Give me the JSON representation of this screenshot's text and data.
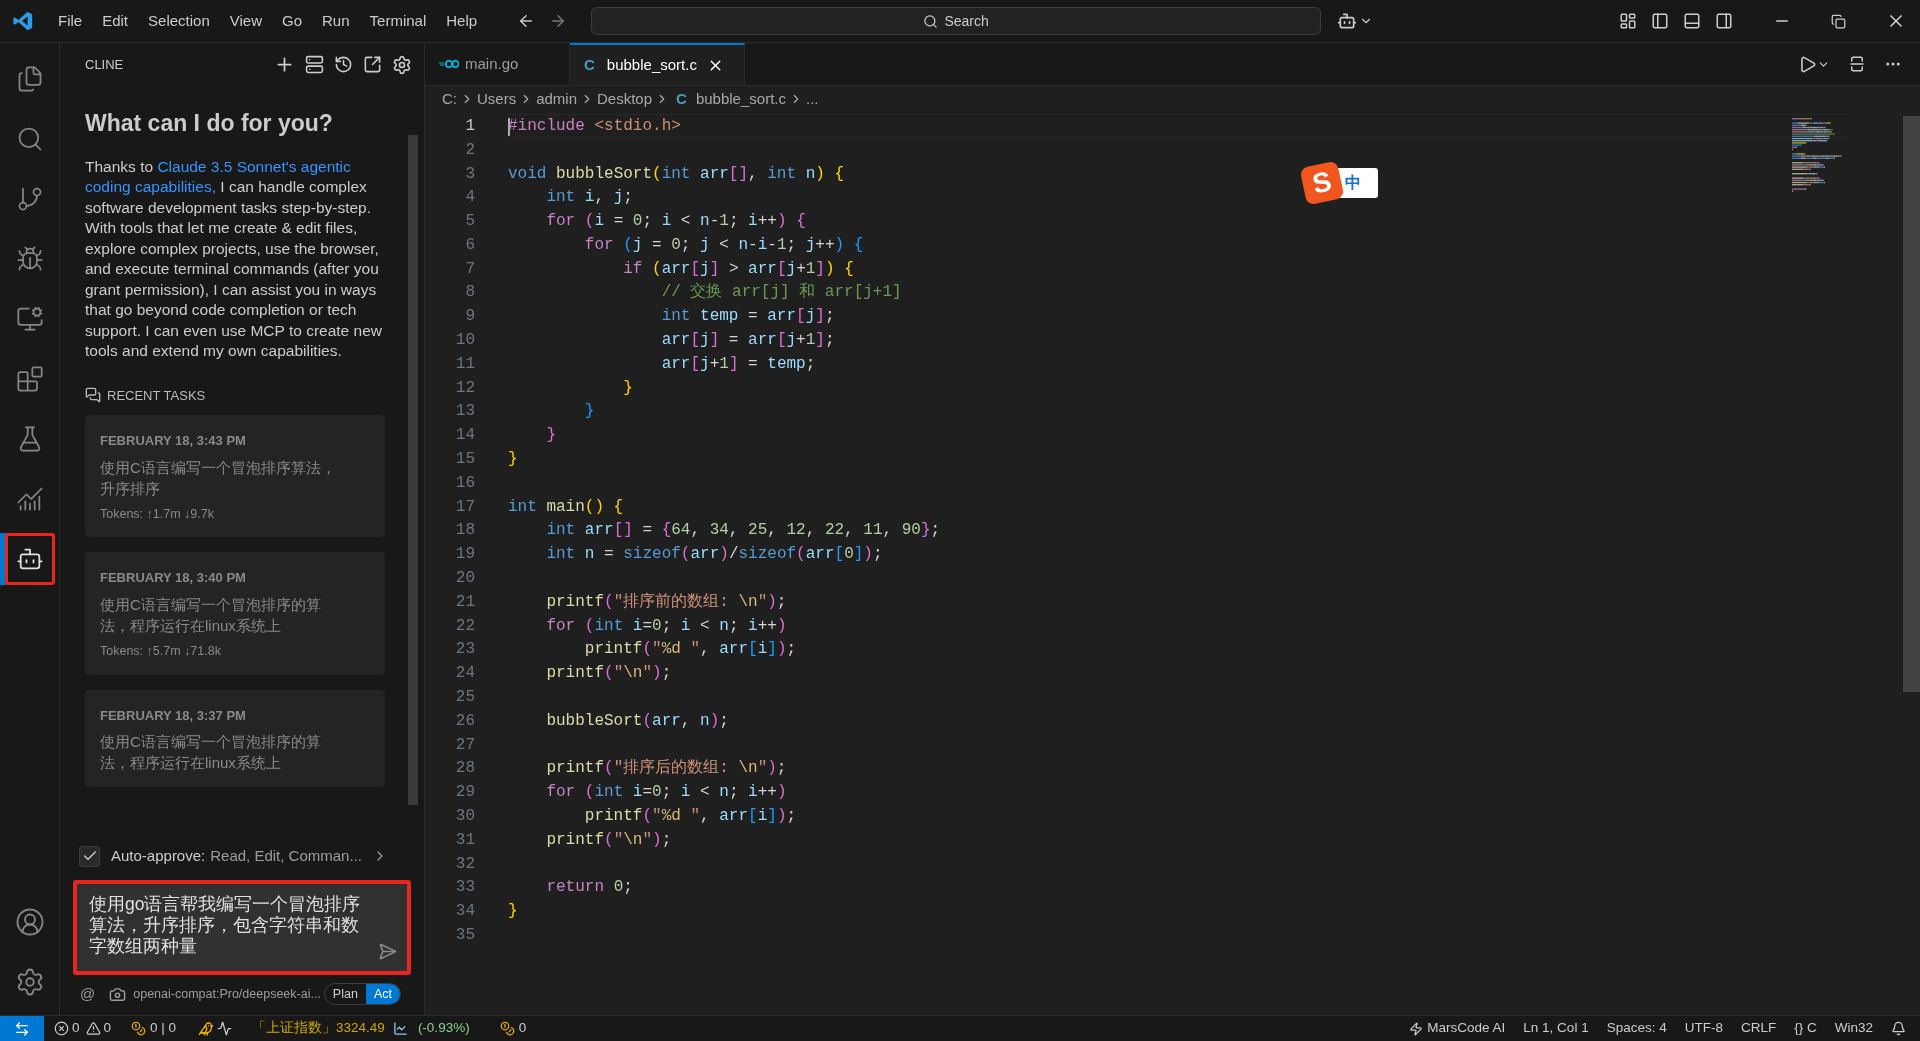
{
  "title_bar": {
    "menu": [
      "File",
      "Edit",
      "Selection",
      "View",
      "Go",
      "Run",
      "Terminal",
      "Help"
    ],
    "search": {
      "placeholder": "Search"
    }
  },
  "activity_bar": {
    "items": [
      {
        "selected": false,
        "annotated": false
      },
      {
        "selected": false,
        "annotated": false
      },
      {
        "selected": false,
        "annotated": false
      },
      {
        "selected": false,
        "annotated": false
      },
      {
        "selected": false,
        "annotated": false
      },
      {
        "selected": false,
        "annotated": false
      },
      {
        "selected": false,
        "annotated": false
      },
      {
        "selected": false,
        "annotated": false
      },
      {
        "selected": true,
        "annotated": true
      }
    ]
  },
  "side_panel": {
    "title": "CLINE",
    "heading": "What can I do for you?",
    "intro_lead": "Thanks to",
    "intro_link": [
      "Claude 3.5 Sonnet's agentic",
      "coding capabilities,"
    ],
    "intro_rest": "I can handle complex software development tasks step-by-step. With tools that let me create & edit files, explore complex projects, use the browser, and execute terminal commands (after you grant permission), I can assist you in ways that go beyond code completion or tech support. I can even use MCP to create new tools and extend my own capabilities.",
    "recent_tasks": {
      "title": "RECENT TASKS",
      "tasks": [
        {
          "date": "FEBRUARY 18, 3:43 PM",
          "text": "使用C语言编写一个冒泡排序算法，升序排序",
          "tokens": "Tokens: ↑1.7m ↓9.7k"
        },
        {
          "date": "FEBRUARY 18, 3:40 PM",
          "text": "使用C语言编写一个冒泡排序的算法，程序运行在linux系统上",
          "tokens": "Tokens: ↑5.7m ↓71.8k"
        },
        {
          "date": "FEBRUARY 18, 3:37 PM",
          "text": "使用C语言编写一个冒泡排序的算法，程序运行在linux系统上"
        }
      ]
    },
    "auto_approve": {
      "checked": true,
      "label": "Auto-approve:",
      "value": "Read, Edit, Comman..."
    },
    "input": {
      "value": "使用go语言帮我编写一个冒泡排序算法，升序排序，包含字符串和数字数组两种量",
      "annotated": true
    },
    "footer": {
      "mention": "@",
      "model": "openai-compat:Pro/deepseek-ai...",
      "modes": [
        {
          "label": "Plan",
          "selected": false
        },
        {
          "label": "Act",
          "selected": true
        }
      ]
    }
  },
  "editor": {
    "tabs": [
      {
        "label": "main.go",
        "selected": false
      },
      {
        "label": "bubble_sort.c",
        "icon_letter": "C",
        "selected": true
      }
    ],
    "breadcrumbs": [
      "C:",
      "Users",
      "admin",
      "Desktop",
      "bubble_sort.c",
      "..."
    ],
    "breadcrumb_icon_letter": "C",
    "ime": {
      "logo": "S",
      "mode": "中"
    },
    "lines": [
      {
        "n": "1",
        "current": true,
        "t": [
          {
            "kind": "pre",
            "text": "#include "
          },
          {
            "kind": "inc",
            "text": "<stdio.h>"
          }
        ]
      },
      {
        "n": "2",
        "current": false
      },
      {
        "n": "3",
        "current": false,
        "t": [
          {
            "kind": "ty",
            "text": "void "
          },
          {
            "kind": "fn",
            "text": "bubbleSort"
          },
          {
            "kind": "b1",
            "text": "("
          },
          {
            "kind": "ty",
            "text": "int "
          },
          {
            "kind": "v",
            "text": "arr"
          },
          {
            "kind": "b2",
            "text": "[]"
          },
          {
            "kind": "p",
            "text": ", "
          },
          {
            "kind": "ty",
            "text": "int "
          },
          {
            "kind": "v",
            "text": "n"
          },
          {
            "kind": "b1",
            "text": ")"
          },
          {
            "kind": "b1",
            "text": " {"
          }
        ]
      },
      {
        "n": "4",
        "current": false,
        "t": [
          {
            "kind": "ty",
            "text": "    int "
          },
          {
            "kind": "v",
            "text": "i"
          },
          {
            "kind": "p",
            "text": ", "
          },
          {
            "kind": "v",
            "text": "j"
          },
          {
            "kind": "p",
            "text": ";"
          }
        ]
      },
      {
        "n": "5",
        "current": false,
        "t": [
          {
            "kind": "kw",
            "text": "    for "
          },
          {
            "kind": "b2",
            "text": "("
          },
          {
            "kind": "v",
            "text": "i"
          },
          {
            "kind": "p",
            "text": " = "
          },
          {
            "kind": "n",
            "text": "0"
          },
          {
            "kind": "p",
            "text": "; "
          },
          {
            "kind": "v",
            "text": "i"
          },
          {
            "kind": "p",
            "text": " < "
          },
          {
            "kind": "v",
            "text": "n"
          },
          {
            "kind": "p",
            "text": "-"
          },
          {
            "kind": "n",
            "text": "1"
          },
          {
            "kind": "p",
            "text": "; "
          },
          {
            "kind": "v",
            "text": "i"
          },
          {
            "kind": "p",
            "text": "++"
          },
          {
            "kind": "b2",
            "text": ")"
          },
          {
            "kind": "b2",
            "text": " {"
          }
        ]
      },
      {
        "n": "6",
        "current": false,
        "t": [
          {
            "kind": "kw",
            "text": "        for "
          },
          {
            "kind": "b3",
            "text": "("
          },
          {
            "kind": "v",
            "text": "j"
          },
          {
            "kind": "p",
            "text": " = "
          },
          {
            "kind": "n",
            "text": "0"
          },
          {
            "kind": "p",
            "text": "; "
          },
          {
            "kind": "v",
            "text": "j"
          },
          {
            "kind": "p",
            "text": " < "
          },
          {
            "kind": "v",
            "text": "n"
          },
          {
            "kind": "p",
            "text": "-"
          },
          {
            "kind": "v",
            "text": "i"
          },
          {
            "kind": "p",
            "text": "-"
          },
          {
            "kind": "n",
            "text": "1"
          },
          {
            "kind": "p",
            "text": "; "
          },
          {
            "kind": "v",
            "text": "j"
          },
          {
            "kind": "p",
            "text": "++"
          },
          {
            "kind": "b3",
            "text": ")"
          },
          {
            "kind": "b3",
            "text": " {"
          }
        ]
      },
      {
        "n": "7",
        "current": false,
        "t": [
          {
            "kind": "kw",
            "text": "            if "
          },
          {
            "kind": "b1",
            "text": "("
          },
          {
            "kind": "v",
            "text": "arr"
          },
          {
            "kind": "b2",
            "text": "["
          },
          {
            "kind": "v",
            "text": "j"
          },
          {
            "kind": "b2",
            "text": "]"
          },
          {
            "kind": "p",
            "text": " > "
          },
          {
            "kind": "v",
            "text": "arr"
          },
          {
            "kind": "b2",
            "text": "["
          },
          {
            "kind": "v",
            "text": "j"
          },
          {
            "kind": "p",
            "text": "+"
          },
          {
            "kind": "n",
            "text": "1"
          },
          {
            "kind": "b2",
            "text": "]"
          },
          {
            "kind": "b1",
            "text": ")"
          },
          {
            "kind": "b1",
            "text": " {"
          }
        ]
      },
      {
        "n": "8",
        "current": false,
        "t": [
          {
            "kind": "c",
            "text": "                // 交换 arr[j] 和 arr[j+1]"
          }
        ]
      },
      {
        "n": "9",
        "current": false,
        "t": [
          {
            "kind": "ty",
            "text": "                int "
          },
          {
            "kind": "v",
            "text": "temp"
          },
          {
            "kind": "p",
            "text": " = "
          },
          {
            "kind": "v",
            "text": "arr"
          },
          {
            "kind": "b2",
            "text": "["
          },
          {
            "kind": "v",
            "text": "j"
          },
          {
            "kind": "b2",
            "text": "]"
          },
          {
            "kind": "p",
            "text": ";"
          }
        ]
      },
      {
        "n": "10",
        "current": false,
        "t": [
          {
            "kind": "v",
            "text": "                arr"
          },
          {
            "kind": "b2",
            "text": "["
          },
          {
            "kind": "v",
            "text": "j"
          },
          {
            "kind": "b2",
            "text": "]"
          },
          {
            "kind": "p",
            "text": " = "
          },
          {
            "kind": "v",
            "text": "arr"
          },
          {
            "kind": "b2",
            "text": "["
          },
          {
            "kind": "v",
            "text": "j"
          },
          {
            "kind": "p",
            "text": "+"
          },
          {
            "kind": "n",
            "text": "1"
          },
          {
            "kind": "b2",
            "text": "]"
          },
          {
            "kind": "p",
            "text": ";"
          }
        ]
      },
      {
        "n": "11",
        "current": false,
        "t": [
          {
            "kind": "v",
            "text": "                arr"
          },
          {
            "kind": "b2",
            "text": "["
          },
          {
            "kind": "v",
            "text": "j"
          },
          {
            "kind": "p",
            "text": "+"
          },
          {
            "kind": "n",
            "text": "1"
          },
          {
            "kind": "b2",
            "text": "]"
          },
          {
            "kind": "p",
            "text": " = "
          },
          {
            "kind": "v",
            "text": "temp"
          },
          {
            "kind": "p",
            "text": ";"
          }
        ]
      },
      {
        "n": "12",
        "current": false,
        "t": [
          {
            "kind": "b1",
            "text": "            }"
          }
        ]
      },
      {
        "n": "13",
        "current": false,
        "t": [
          {
            "kind": "b3",
            "text": "        }"
          }
        ]
      },
      {
        "n": "14",
        "current": false,
        "t": [
          {
            "kind": "b2",
            "text": "    }"
          }
        ]
      },
      {
        "n": "15",
        "current": false,
        "t": [
          {
            "kind": "b1",
            "text": "}"
          }
        ]
      },
      {
        "n": "16",
        "current": false
      },
      {
        "n": "17",
        "current": false,
        "t": [
          {
            "kind": "ty",
            "text": "int "
          },
          {
            "kind": "fn",
            "text": "main"
          },
          {
            "kind": "b1",
            "text": "()"
          },
          {
            "kind": "b1",
            "text": " {"
          }
        ]
      },
      {
        "n": "18",
        "current": false,
        "t": [
          {
            "kind": "ty",
            "text": "    int "
          },
          {
            "kind": "v",
            "text": "arr"
          },
          {
            "kind": "b2",
            "text": "[]"
          },
          {
            "kind": "p",
            "text": " = "
          },
          {
            "kind": "b2",
            "text": "{"
          },
          {
            "kind": "n",
            "text": "64"
          },
          {
            "kind": "p",
            "text": ", "
          },
          {
            "kind": "n",
            "text": "34"
          },
          {
            "kind": "p",
            "text": ", "
          },
          {
            "kind": "n",
            "text": "25"
          },
          {
            "kind": "p",
            "text": ", "
          },
          {
            "kind": "n",
            "text": "12"
          },
          {
            "kind": "p",
            "text": ", "
          },
          {
            "kind": "n",
            "text": "22"
          },
          {
            "kind": "p",
            "text": ", "
          },
          {
            "kind": "n",
            "text": "11"
          },
          {
            "kind": "p",
            "text": ", "
          },
          {
            "kind": "n",
            "text": "90"
          },
          {
            "kind": "b2",
            "text": "}"
          },
          {
            "kind": "p",
            "text": ";"
          }
        ]
      },
      {
        "n": "19",
        "current": false,
        "t": [
          {
            "kind": "ty",
            "text": "    int "
          },
          {
            "kind": "v",
            "text": "n"
          },
          {
            "kind": "p",
            "text": " = "
          },
          {
            "kind": "ty",
            "text": "sizeof"
          },
          {
            "kind": "b2",
            "text": "("
          },
          {
            "kind": "v",
            "text": "arr"
          },
          {
            "kind": "b2",
            "text": ")"
          },
          {
            "kind": "p",
            "text": "/"
          },
          {
            "kind": "ty",
            "text": "sizeof"
          },
          {
            "kind": "b2",
            "text": "("
          },
          {
            "kind": "v",
            "text": "arr"
          },
          {
            "kind": "b3",
            "text": "["
          },
          {
            "kind": "n",
            "text": "0"
          },
          {
            "kind": "b3",
            "text": "]"
          },
          {
            "kind": "b2",
            "text": ")"
          },
          {
            "kind": "p",
            "text": ";"
          }
        ]
      },
      {
        "n": "20",
        "current": false
      },
      {
        "n": "21",
        "current": false,
        "t": [
          {
            "kind": "fn",
            "text": "    printf"
          },
          {
            "kind": "b2",
            "text": "("
          },
          {
            "kind": "s",
            "text": "\"排序前的数组: "
          },
          {
            "kind": "esc",
            "text": "\\n"
          },
          {
            "kind": "s",
            "text": "\""
          },
          {
            "kind": "b2",
            "text": ")"
          },
          {
            "kind": "p",
            "text": ";"
          }
        ]
      },
      {
        "n": "22",
        "current": false,
        "t": [
          {
            "kind": "kw",
            "text": "    for "
          },
          {
            "kind": "b2",
            "text": "("
          },
          {
            "kind": "ty",
            "text": "int "
          },
          {
            "kind": "v",
            "text": "i"
          },
          {
            "kind": "p",
            "text": "="
          },
          {
            "kind": "n",
            "text": "0"
          },
          {
            "kind": "p",
            "text": "; "
          },
          {
            "kind": "v",
            "text": "i"
          },
          {
            "kind": "p",
            "text": " < "
          },
          {
            "kind": "v",
            "text": "n"
          },
          {
            "kind": "p",
            "text": "; "
          },
          {
            "kind": "v",
            "text": "i"
          },
          {
            "kind": "p",
            "text": "++"
          },
          {
            "kind": "b2",
            "text": ")"
          }
        ]
      },
      {
        "n": "23",
        "current": false,
        "t": [
          {
            "kind": "fn",
            "text": "        printf"
          },
          {
            "kind": "b2",
            "text": "("
          },
          {
            "kind": "s",
            "text": "\""
          },
          {
            "kind": "esc",
            "text": "%d"
          },
          {
            "kind": "s",
            "text": " \""
          },
          {
            "kind": "p",
            "text": ", "
          },
          {
            "kind": "v",
            "text": "arr"
          },
          {
            "kind": "b3",
            "text": "["
          },
          {
            "kind": "v",
            "text": "i"
          },
          {
            "kind": "b3",
            "text": "]"
          },
          {
            "kind": "b2",
            "text": ")"
          },
          {
            "kind": "p",
            "text": ";"
          }
        ]
      },
      {
        "n": "24",
        "current": false,
        "t": [
          {
            "kind": "fn",
            "text": "    printf"
          },
          {
            "kind": "b2",
            "text": "("
          },
          {
            "kind": "s",
            "text": "\""
          },
          {
            "kind": "esc",
            "text": "\\n"
          },
          {
            "kind": "s",
            "text": "\""
          },
          {
            "kind": "b2",
            "text": ")"
          },
          {
            "kind": "p",
            "text": ";"
          }
        ]
      },
      {
        "n": "25",
        "current": false
      },
      {
        "n": "26",
        "current": false,
        "t": [
          {
            "kind": "fn",
            "text": "    bubbleSort"
          },
          {
            "kind": "b2",
            "text": "("
          },
          {
            "kind": "v",
            "text": "arr"
          },
          {
            "kind": "p",
            "text": ", "
          },
          {
            "kind": "v",
            "text": "n"
          },
          {
            "kind": "b2",
            "text": ")"
          },
          {
            "kind": "p",
            "text": ";"
          }
        ]
      },
      {
        "n": "27",
        "current": false
      },
      {
        "n": "28",
        "current": false,
        "t": [
          {
            "kind": "fn",
            "text": "    printf"
          },
          {
            "kind": "b2",
            "text": "("
          },
          {
            "kind": "s",
            "text": "\"排序后的数组: "
          },
          {
            "kind": "esc",
            "text": "\\n"
          },
          {
            "kind": "s",
            "text": "\""
          },
          {
            "kind": "b2",
            "text": ")"
          },
          {
            "kind": "p",
            "text": ";"
          }
        ]
      },
      {
        "n": "29",
        "current": false,
        "t": [
          {
            "kind": "kw",
            "text": "    for "
          },
          {
            "kind": "b2",
            "text": "("
          },
          {
            "kind": "ty",
            "text": "int "
          },
          {
            "kind": "v",
            "text": "i"
          },
          {
            "kind": "p",
            "text": "="
          },
          {
            "kind": "n",
            "text": "0"
          },
          {
            "kind": "p",
            "text": "; "
          },
          {
            "kind": "v",
            "text": "i"
          },
          {
            "kind": "p",
            "text": " < "
          },
          {
            "kind": "v",
            "text": "n"
          },
          {
            "kind": "p",
            "text": "; "
          },
          {
            "kind": "v",
            "text": "i"
          },
          {
            "kind": "p",
            "text": "++"
          },
          {
            "kind": "b2",
            "text": ")"
          }
        ]
      },
      {
        "n": "30",
        "current": false,
        "t": [
          {
            "kind": "fn",
            "text": "        printf"
          },
          {
            "kind": "b2",
            "text": "("
          },
          {
            "kind": "s",
            "text": "\""
          },
          {
            "kind": "esc",
            "text": "%d"
          },
          {
            "kind": "s",
            "text": " \""
          },
          {
            "kind": "p",
            "text": ", "
          },
          {
            "kind": "v",
            "text": "arr"
          },
          {
            "kind": "b3",
            "text": "["
          },
          {
            "kind": "v",
            "text": "i"
          },
          {
            "kind": "b3",
            "text": "]"
          },
          {
            "kind": "b2",
            "text": ")"
          },
          {
            "kind": "p",
            "text": ";"
          }
        ]
      },
      {
        "n": "31",
        "current": false,
        "t": [
          {
            "kind": "fn",
            "text": "    printf"
          },
          {
            "kind": "b2",
            "text": "("
          },
          {
            "kind": "s",
            "text": "\""
          },
          {
            "kind": "esc",
            "text": "\\n"
          },
          {
            "kind": "s",
            "text": "\""
          },
          {
            "kind": "b2",
            "text": ")"
          },
          {
            "kind": "p",
            "text": ";"
          }
        ]
      },
      {
        "n": "32",
        "current": false
      },
      {
        "n": "33",
        "current": false,
        "t": [
          {
            "kind": "kw",
            "text": "    return "
          },
          {
            "kind": "n",
            "text": "0"
          },
          {
            "kind": "p",
            "text": ";"
          }
        ]
      },
      {
        "n": "34",
        "current": false,
        "t": [
          {
            "kind": "b1",
            "text": "}"
          }
        ]
      },
      {
        "n": "35",
        "current": false
      }
    ]
  },
  "status_bar": {
    "errors": "0",
    "warnings": "0",
    "coins": "0 | 0",
    "stock": "「上证指数」3324.49",
    "stock_change": "(-0.93%)",
    "coins2": "0",
    "right": [
      "Ln 1, Col 1",
      "Spaces: 4",
      "UTF-8",
      "CRLF",
      "{} C",
      "Win32"
    ],
    "ai": "MarsCode AI"
  }
}
